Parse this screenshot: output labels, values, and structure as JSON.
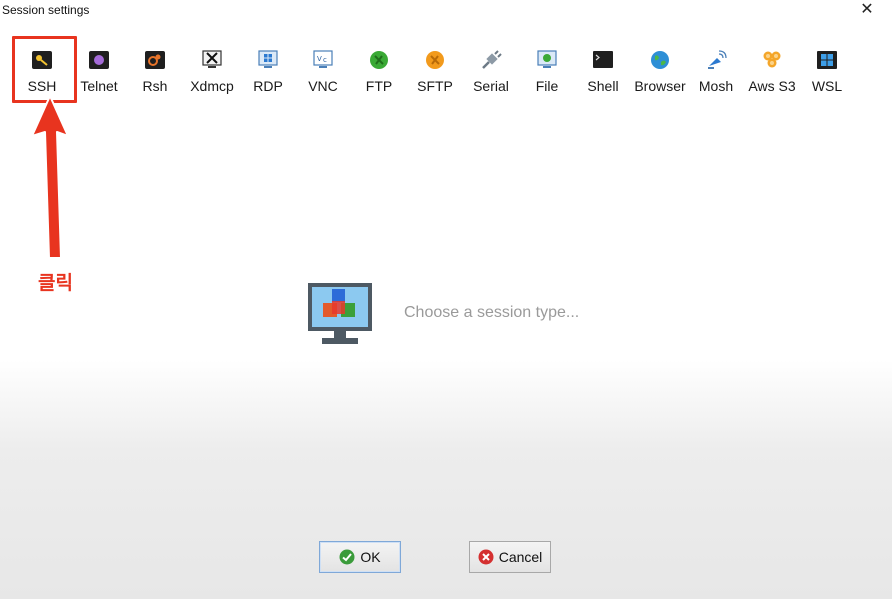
{
  "window": {
    "title": "Session settings",
    "close_glyph": "✕"
  },
  "session_types": [
    {
      "label": "SSH",
      "icon": "ssh-key-icon"
    },
    {
      "label": "Telnet",
      "icon": "telnet-icon"
    },
    {
      "label": "Rsh",
      "icon": "rsh-icon"
    },
    {
      "label": "Xdmcp",
      "icon": "xdmcp-icon"
    },
    {
      "label": "RDP",
      "icon": "rdp-icon"
    },
    {
      "label": "VNC",
      "icon": "vnc-icon"
    },
    {
      "label": "FTP",
      "icon": "ftp-icon"
    },
    {
      "label": "SFTP",
      "icon": "sftp-icon"
    },
    {
      "label": "Serial",
      "icon": "serial-plug-icon"
    },
    {
      "label": "File",
      "icon": "file-icon"
    },
    {
      "label": "Shell",
      "icon": "shell-icon"
    },
    {
      "label": "Browser",
      "icon": "browser-globe-icon"
    },
    {
      "label": "Mosh",
      "icon": "mosh-satellite-icon"
    },
    {
      "label": "Aws S3",
      "icon": "aws-s3-icon"
    },
    {
      "label": "WSL",
      "icon": "wsl-icon"
    }
  ],
  "annotation": {
    "text": "클릭",
    "color": "#e8341f"
  },
  "main": {
    "prompt": "Choose a session type..."
  },
  "buttons": {
    "ok_label": "OK",
    "cancel_label": "Cancel"
  }
}
